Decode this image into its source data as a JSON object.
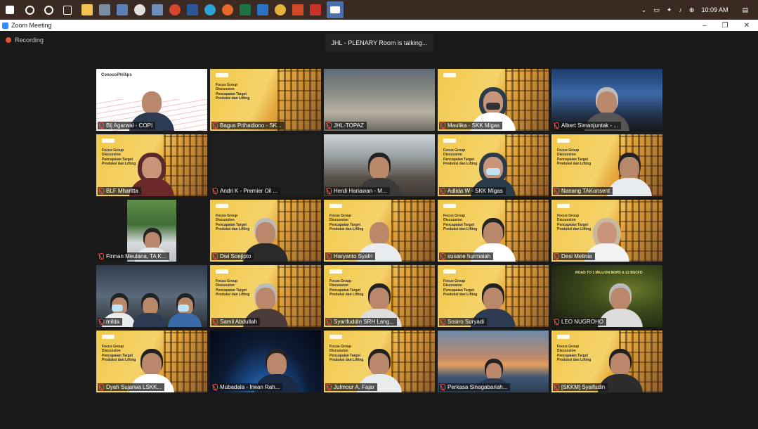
{
  "system_tray": {
    "clock": "10:09 AM"
  },
  "window": {
    "title": "Zoom Meeting",
    "minimize": "–",
    "restore": "❐",
    "close": "✕"
  },
  "meeting": {
    "recording_label": "Recording",
    "talking_indicator": "JHL - PLENARY Room is talking..."
  },
  "slide": {
    "lines": [
      "Focus Group",
      "Discussion",
      "Pencapaian Target",
      "Produksi dan Lifting"
    ]
  },
  "road_slide_title": "ROAD TO 1 MILLION BOPD & 12 BSCFD",
  "brand_text": "ConocoPhillips",
  "participants": [
    {
      "name": "Bij Agarwal - COPI"
    },
    {
      "name": "Bagus Prihadiono - SK..."
    },
    {
      "name": "JHL-TOPAZ"
    },
    {
      "name": "Maulika - SKK Migas"
    },
    {
      "name": "Albert Simanjuntak - ..."
    },
    {
      "name": "BLF Mharitta"
    },
    {
      "name": "Andri K - Premier Oil ..."
    },
    {
      "name": "Herdi Hariawan - M..."
    },
    {
      "name": "Adlida W - SKK Migas"
    },
    {
      "name": "Nanang TAKonsent"
    },
    {
      "name": "Firman Meulana, TA K..."
    },
    {
      "name": "Dwi Soejipto"
    },
    {
      "name": "Haryanto Syafri"
    },
    {
      "name": "susane hurmaiah"
    },
    {
      "name": "Desi Melinia"
    },
    {
      "name": "milda"
    },
    {
      "name": "Samil Abdullah"
    },
    {
      "name": "Syarifuddin SRH Lang..."
    },
    {
      "name": "Sosiro Suryadi"
    },
    {
      "name": "LEO NUGROHO"
    },
    {
      "name": "Dyah Sujarwa LSKK..."
    },
    {
      "name": "Mubadala - Irwan Rah..."
    },
    {
      "name": "Julmour A. Fajar"
    },
    {
      "name": "Perkasa Sinagabariah..."
    },
    {
      "name": "[SKKM] Syaifudin"
    }
  ],
  "colors": {
    "taskbar": "#3a2a22",
    "meeting_bg": "#1a1a1a",
    "muted_mic": "#ff4a4a",
    "slide_yellow": "#f2c94c"
  }
}
